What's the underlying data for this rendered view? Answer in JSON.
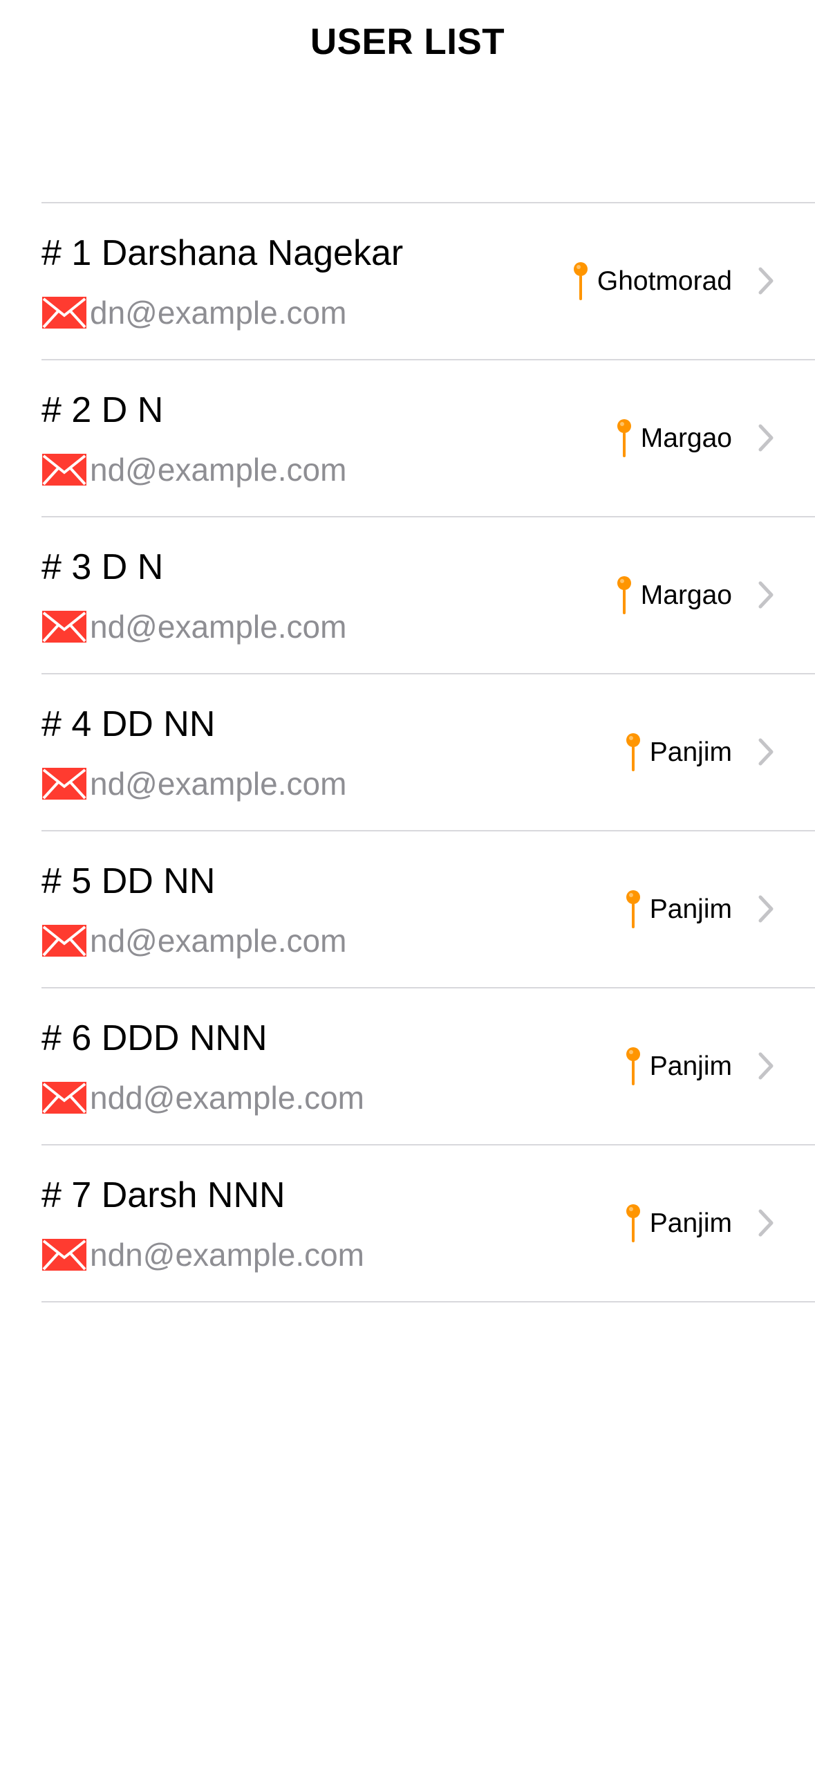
{
  "header": {
    "title": "USER LIST"
  },
  "users": [
    {
      "title": "# 1 Darshana Nagekar",
      "email": "dn@example.com",
      "location": "Ghotmorad"
    },
    {
      "title": "# 2 D N",
      "email": "nd@example.com",
      "location": "Margao"
    },
    {
      "title": "# 3 D N",
      "email": "nd@example.com",
      "location": "Margao"
    },
    {
      "title": "# 4 DD NN",
      "email": "nd@example.com",
      "location": "Panjim"
    },
    {
      "title": "# 5 DD NN",
      "email": "nd@example.com",
      "location": "Panjim"
    },
    {
      "title": "# 6 DDD NNN",
      "email": "ndd@example.com",
      "location": "Panjim"
    },
    {
      "title": "# 7 Darsh NNN",
      "email": "ndn@example.com",
      "location": "Panjim"
    }
  ],
  "icons": {
    "mail": "envelope-icon",
    "location": "map-pin-icon",
    "disclosure": "chevron-right-icon"
  },
  "colors": {
    "mail_icon": "#ff3b30",
    "pin_icon": "#ff9500",
    "email_text": "#8e8e93",
    "separator": "#d8d8dc",
    "chevron": "#c4c4c7"
  }
}
